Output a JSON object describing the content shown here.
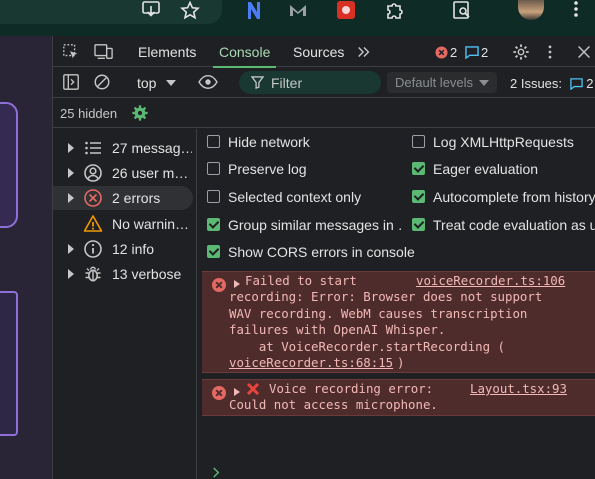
{
  "devtools": {
    "tabs": [
      "Elements",
      "Console",
      "Sources"
    ],
    "error_count": "2",
    "warning_count": "2"
  },
  "toolbar": {
    "context": "top",
    "filter_placeholder": "Filter",
    "levels": "Default levels",
    "issues_label": "2 Issues:",
    "issues_count": "2"
  },
  "hidden_label": "25 hidden",
  "sidebar": {
    "items": [
      {
        "label": "27 messag…",
        "icon": "list-icon"
      },
      {
        "label": "26 user m…",
        "icon": "user-icon"
      },
      {
        "label": "2 errors",
        "icon": "error-icon"
      },
      {
        "label": "No warnin…",
        "icon": "warning-icon"
      },
      {
        "label": "12 info",
        "icon": "info-icon"
      },
      {
        "label": "13 verbose",
        "icon": "bug-icon"
      }
    ]
  },
  "settings": {
    "left": [
      {
        "label": "Hide network",
        "checked": false
      },
      {
        "label": "Preserve log",
        "checked": false
      },
      {
        "label": "Selected context only",
        "checked": false
      },
      {
        "label": "Group similar messages in …",
        "checked": true
      },
      {
        "label": "Show CORS errors in console",
        "checked": true
      }
    ],
    "right": [
      {
        "label": "Log XMLHttpRequests",
        "checked": false
      },
      {
        "label": "Eager evaluation",
        "checked": true
      },
      {
        "label": "Autocomplete from history",
        "checked": true
      },
      {
        "label": "Treat code evaluation as us…",
        "checked": true
      }
    ]
  },
  "messages": [
    {
      "line1": "Failed to start",
      "source": "voiceRecorder.ts:106",
      "line2": "recording: Error: Browser does not support",
      "line3": "WAV recording. WebM causes transcription",
      "line4": "failures with OpenAI Whisper.",
      "line5": "    at VoiceRecorder.startRecording (",
      "line6_link": "voiceRecorder.ts:68:15",
      "line6_end": ")"
    },
    {
      "line1": "Voice recording error:",
      "source": "Layout.tsx:93",
      "line2": "Could not access microphone."
    }
  ],
  "colors": {
    "accent": "#5bb974",
    "error_bg": "#4e2c2c",
    "error_text": "#f2b8b5"
  }
}
